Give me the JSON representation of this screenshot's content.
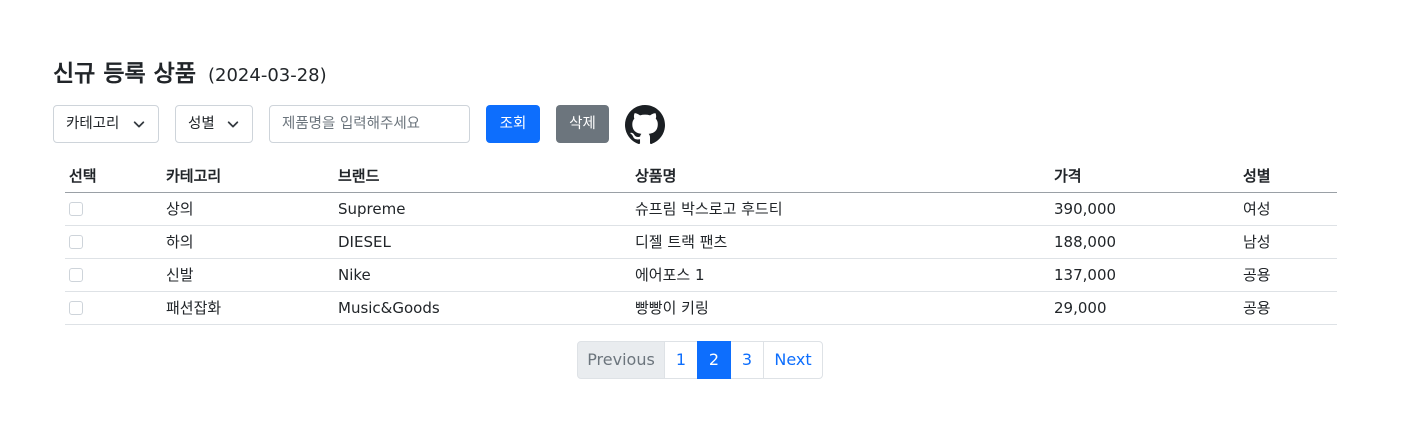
{
  "header": {
    "title": "신규 등록 상품",
    "date": "(2024-03-28)"
  },
  "filters": {
    "category_label": "카테고리",
    "gender_label": "성별",
    "search_placeholder": "제품명을 입력해주세요",
    "search_button": "조회",
    "delete_button": "삭제",
    "github_icon": "github-icon"
  },
  "table": {
    "columns": [
      "선택",
      "카테고리",
      "브랜드",
      "상품명",
      "가격",
      "성별"
    ],
    "rows": [
      {
        "category": "상의",
        "brand": "Supreme",
        "name": "슈프림 박스로고 후드티",
        "price": "390,000",
        "gender": "여성",
        "checked": false
      },
      {
        "category": "하의",
        "brand": "DIESEL",
        "name": "디젤 트랙 팬츠",
        "price": "188,000",
        "gender": "남성",
        "checked": false
      },
      {
        "category": "신발",
        "brand": "Nike",
        "name": "에어포스 1",
        "price": "137,000",
        "gender": "공용",
        "checked": false
      },
      {
        "category": "패션잡화",
        "brand": "Music&Goods",
        "name": "빵빵이 키링",
        "price": "29,000",
        "gender": "공용",
        "checked": false
      }
    ]
  },
  "pagination": {
    "previous": "Previous",
    "pages": [
      "1",
      "2",
      "3"
    ],
    "current": "2",
    "next": "Next"
  },
  "colors": {
    "primary": "#0d6efd",
    "secondary": "#6c757d",
    "disabled_bg": "#e9ecef"
  }
}
